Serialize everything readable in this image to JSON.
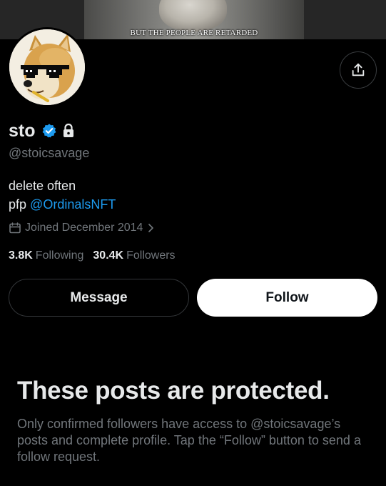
{
  "banner": {
    "caption": "BUT THE PEOPLE ARE RETARDED"
  },
  "profile": {
    "name": "sto",
    "handle": "@stoicsavage",
    "bio_line1": "delete often",
    "bio_pfp_prefix": "pfp",
    "bio_mention": "@OrdinalsNFT",
    "joined": "Joined December 2014",
    "following_count": "3.8K",
    "following_label": "Following",
    "followers_count": "30.4K",
    "followers_label": "Followers"
  },
  "actions": {
    "message_label": "Message",
    "follow_label": "Follow"
  },
  "protected": {
    "title": "These posts are protected.",
    "body": "Only confirmed followers have access to @stoicsavage’s posts and complete profile. Tap the “Follow” button to send a follow request."
  },
  "icons": {
    "share": "share-icon",
    "verified": "verified-badge-icon",
    "lock": "lock-icon",
    "calendar": "calendar-icon",
    "chevron": "chevron-right-icon"
  },
  "colors": {
    "accent": "#1d9bf0",
    "muted": "#71767b",
    "text": "#e7e9ea",
    "background": "#000000"
  }
}
